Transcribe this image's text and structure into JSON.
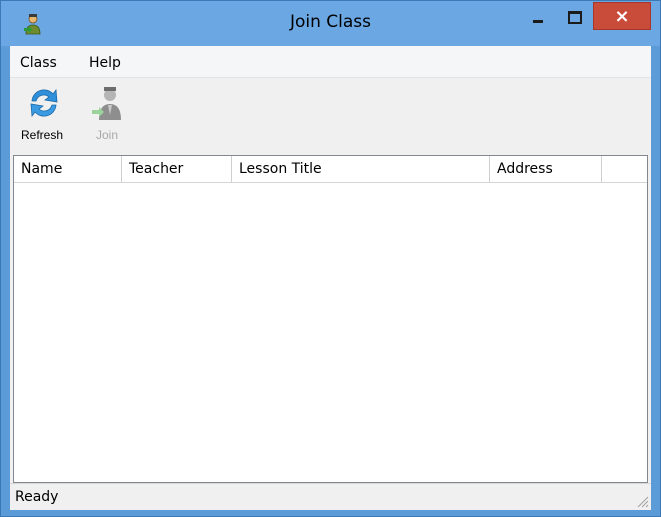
{
  "window": {
    "title": "Join Class",
    "controls": {
      "minimize": "minimize",
      "maximize": "maximize",
      "close": "×"
    }
  },
  "menu": [
    {
      "label": "Class"
    },
    {
      "label": "Help"
    }
  ],
  "toolbar": {
    "refresh": {
      "label": "Refresh",
      "icon": "refresh-icon"
    },
    "join": {
      "label": "Join",
      "icon": "person-join-icon",
      "enabled": false
    }
  },
  "table": {
    "columns": [
      "Name",
      "Teacher",
      "Lesson Title",
      "Address",
      ""
    ],
    "rows": []
  },
  "status": {
    "text": "Ready"
  },
  "colors": {
    "titlebar": "#6aa7e3",
    "close_button": "#c94b3a",
    "refresh_icon": "#2f8fd8"
  }
}
